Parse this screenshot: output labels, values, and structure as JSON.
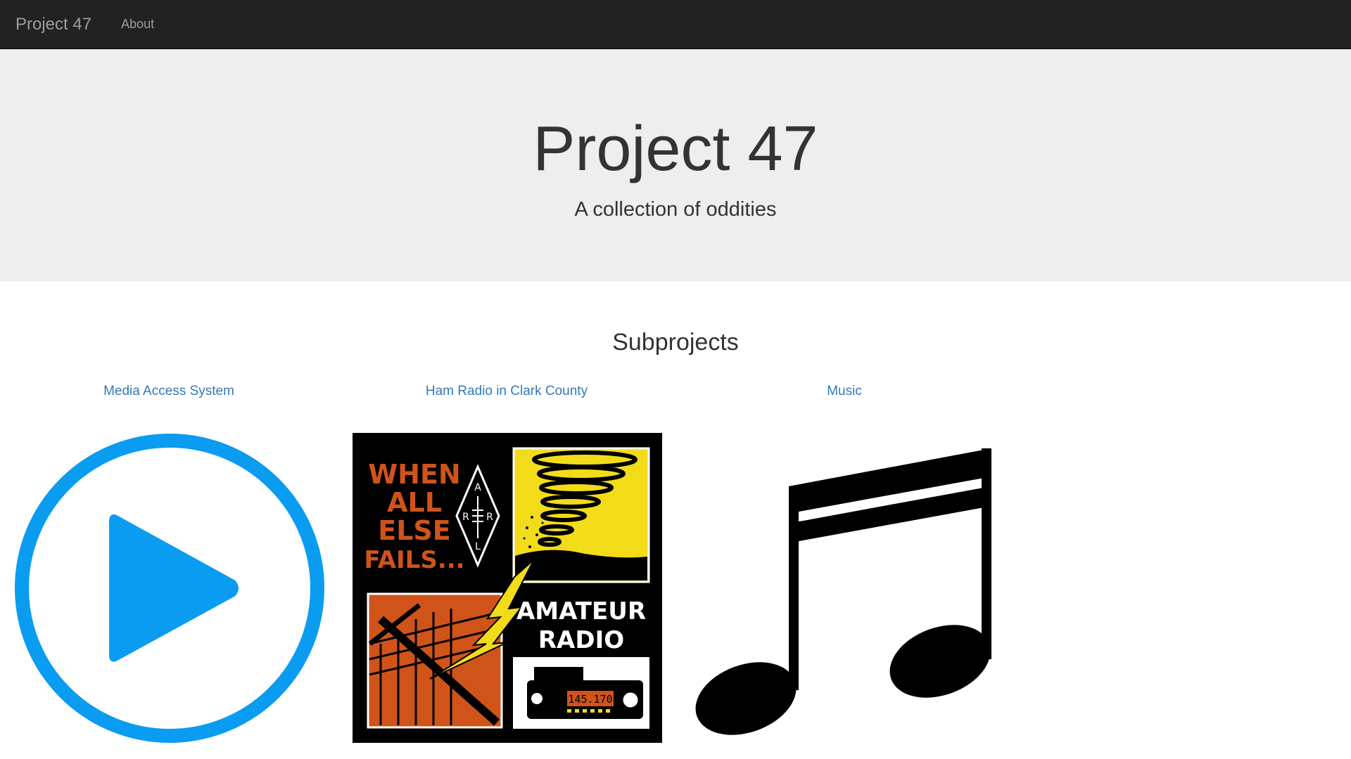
{
  "navbar": {
    "brand": "Project 47",
    "links": [
      {
        "label": "About"
      }
    ]
  },
  "hero": {
    "title": "Project 47",
    "subtitle": "A collection of oddities"
  },
  "subprojects": {
    "heading": "Subprojects",
    "items": [
      {
        "title": "Media Access System",
        "icon": "play-circle-icon"
      },
      {
        "title": "Ham Radio in Clark County",
        "icon": "ham-radio-poster-image"
      },
      {
        "title": "Music",
        "icon": "music-note-icon"
      }
    ]
  },
  "ham_poster": {
    "text_when": "WHEN",
    "text_all": "ALL",
    "text_else": "ELSE",
    "text_fails": "FAILS...",
    "text_amateur": "AMATEUR",
    "text_radio": "RADIO",
    "radio_display": "145.170",
    "arrl_letters": [
      "A",
      "R",
      "R",
      "L"
    ]
  },
  "colors": {
    "navbar_bg": "#222222",
    "hero_bg": "#eeeeee",
    "link": "#337ab7",
    "play_blue": "#0a9cf0",
    "ham_orange": "#d0541a",
    "ham_yellow": "#f2dc1a"
  }
}
